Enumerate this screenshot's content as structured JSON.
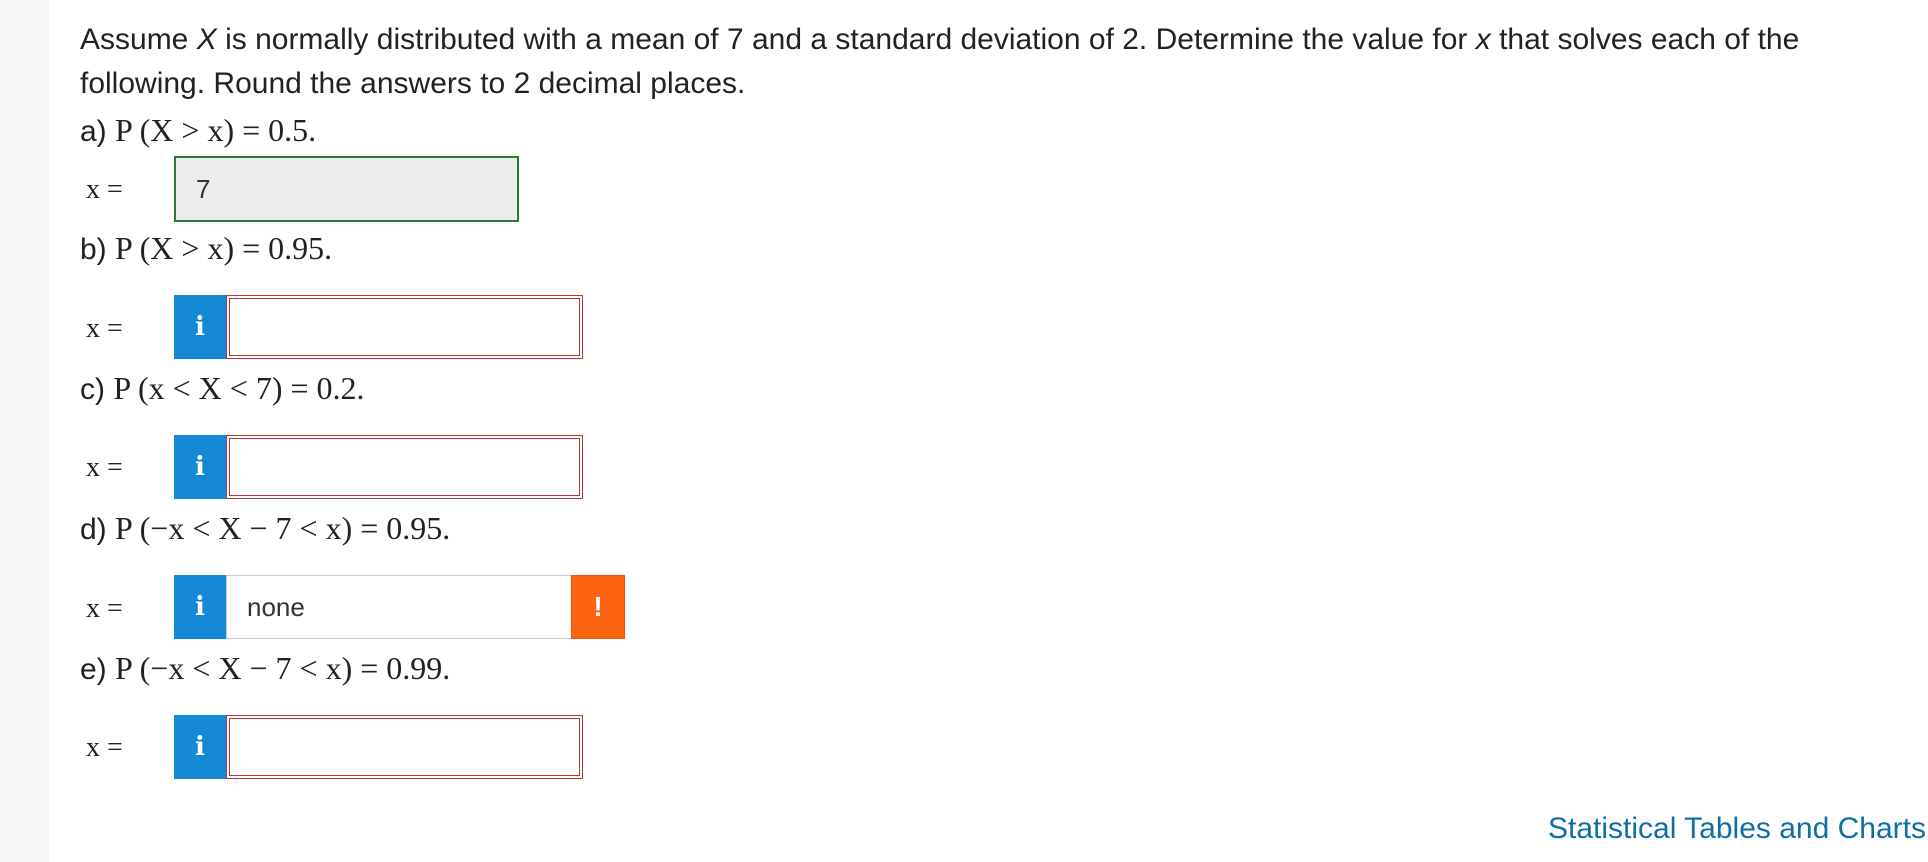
{
  "question": {
    "prefix": "Assume ",
    "var_X": "X",
    "middle": " is normally distributed with a mean of 7 and a standard deviation of 2. Determine the value for ",
    "var_x": "x",
    "suffix": " that solves each of the following. Round the answers to 2 decimal places."
  },
  "x_equals_label": "x =",
  "info_icon": "i",
  "alert_icon": "!",
  "parts": [
    {
      "letter": "a)",
      "expression": "P (X > x) = 0.5.",
      "answer_value": "7",
      "answer_state": "correct"
    },
    {
      "letter": "b)",
      "expression": "P (X > x) = 0.95.",
      "answer_value": "",
      "answer_state": "error"
    },
    {
      "letter": "c)",
      "expression": "P (x < X < 7) = 0.2.",
      "answer_value": "",
      "answer_state": "error"
    },
    {
      "letter": "d)",
      "expression": "P (−x < X − 7 < x) = 0.95.",
      "answer_value": "none",
      "answer_state": "warning"
    },
    {
      "letter": "e)",
      "expression": "P (−x < X − 7 < x) = 0.99.",
      "answer_value": "",
      "answer_state": "error"
    }
  ],
  "footer_link": "Statistical Tables and Charts",
  "colors": {
    "info_blue": "#1689d6",
    "error_red": "#b03a3a",
    "correct_green": "#2e7d32",
    "alert_orange": "#fd6412",
    "link_blue": "#0e6fa3"
  }
}
